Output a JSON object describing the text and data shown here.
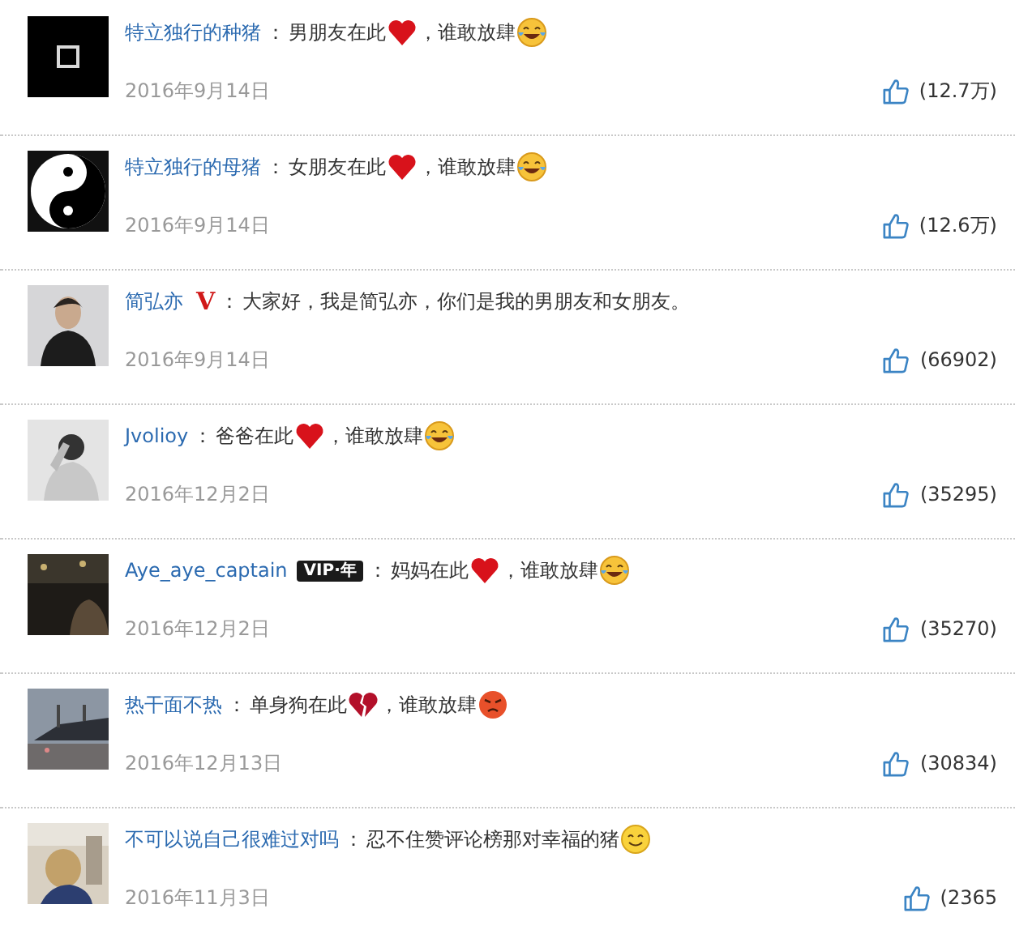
{
  "comments": [
    {
      "name": "特立独行的种猪",
      "separator": "：",
      "parts": [
        {
          "kind": "text",
          "text": "男朋友在此"
        },
        {
          "kind": "heart"
        },
        {
          "kind": "text",
          "text": "，谁敢放肆"
        },
        {
          "kind": "laugh-cry"
        }
      ],
      "date": "2016年9月14日",
      "likes": "(12.7万)"
    },
    {
      "name": "特立独行的母猪",
      "separator": "：",
      "parts": [
        {
          "kind": "text",
          "text": "女朋友在此"
        },
        {
          "kind": "heart"
        },
        {
          "kind": "text",
          "text": "，谁敢放肆"
        },
        {
          "kind": "laugh-cry"
        }
      ],
      "date": "2016年9月14日",
      "likes": "(12.6万)"
    },
    {
      "name": "简弘亦",
      "badge": {
        "kind": "verified",
        "text": "V"
      },
      "separator": "：",
      "parts": [
        {
          "kind": "text",
          "text": "大家好，我是简弘亦，你们是我的男朋友和女朋友。"
        }
      ],
      "date": "2016年9月14日",
      "likes": "(66902)"
    },
    {
      "name": "Jvolioy",
      "separator": "：",
      "parts": [
        {
          "kind": "text",
          "text": "爸爸在此"
        },
        {
          "kind": "heart"
        },
        {
          "kind": "text",
          "text": "，谁敢放肆"
        },
        {
          "kind": "laugh-cry"
        }
      ],
      "date": "2016年12月2日",
      "likes": "(35295)"
    },
    {
      "name": "Aye_aye_captain",
      "badge": {
        "kind": "vip",
        "text": "VIP·年"
      },
      "separator": "：",
      "parts": [
        {
          "kind": "text",
          "text": "妈妈在此"
        },
        {
          "kind": "heart"
        },
        {
          "kind": "text",
          "text": "，谁敢放肆"
        },
        {
          "kind": "laugh-cry"
        }
      ],
      "date": "2016年12月2日",
      "likes": "(35270)"
    },
    {
      "name": "热干面不热",
      "separator": "：",
      "parts": [
        {
          "kind": "text",
          "text": "单身狗在此"
        },
        {
          "kind": "broken-heart"
        },
        {
          "kind": "text",
          "text": "，谁敢放肆"
        },
        {
          "kind": "angry"
        }
      ],
      "date": "2016年12月13日",
      "likes": "(30834)"
    },
    {
      "name": "不可以说自己很难过对吗",
      "separator": "：",
      "parts": [
        {
          "kind": "text",
          "text": "忍不住赞评论榜那对幸福的猪"
        },
        {
          "kind": "smile"
        }
      ],
      "date": "2016年11月3日",
      "likes": "(2365"
    }
  ]
}
